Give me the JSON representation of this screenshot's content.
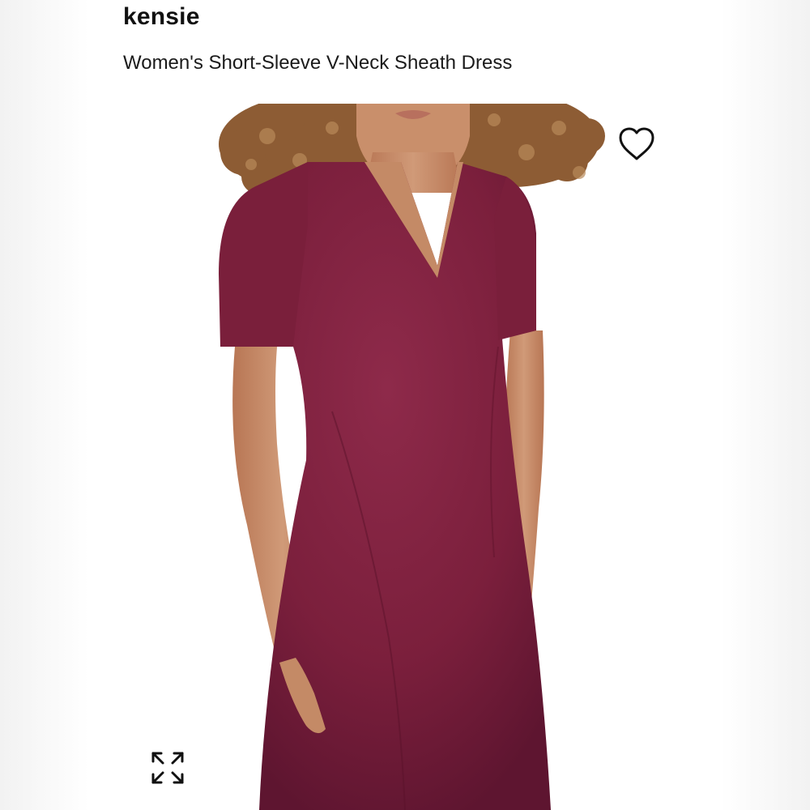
{
  "header": {
    "brand": "kensie",
    "product_title": "Women's Short-Sleeve V-Neck Sheath Dress"
  },
  "product_image": {
    "dress_color": "#7e1f3d",
    "skin_color": "#c68a66",
    "hair_color": "#8a5a33"
  },
  "actions": {
    "wishlist_icon": "heart-icon",
    "zoom_icon": "expand-icon"
  }
}
